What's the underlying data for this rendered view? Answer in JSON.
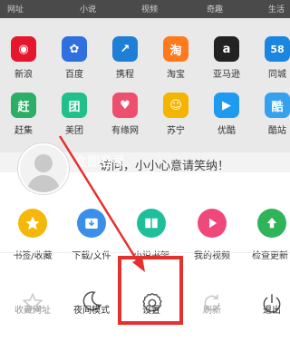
{
  "topnav": [
    "网址",
    "小说",
    "视频",
    "奇趣",
    "生活"
  ],
  "apps_row1": [
    {
      "label": "新浪",
      "icon": "weibo-icon",
      "color": "#e6162d",
      "glyph": "◉"
    },
    {
      "label": "百度",
      "icon": "baidu-paw-icon",
      "color": "#2f6fe0",
      "glyph": "✿"
    },
    {
      "label": "携程",
      "icon": "ctrip-icon",
      "color": "#1f7fd6",
      "glyph": "↗"
    },
    {
      "label": "淘宝",
      "icon": "taobao-icon",
      "color": "#ff7a1c",
      "glyph": "淘"
    },
    {
      "label": "亚马逊",
      "icon": "amazon-icon",
      "color": "#222222",
      "glyph": "a"
    },
    {
      "label": "同城",
      "icon": "tongcheng-icon",
      "color": "#1b86e0",
      "glyph": "58"
    }
  ],
  "apps_row2": [
    {
      "label": "赶集",
      "icon": "ganji-icon",
      "color": "#2bae66",
      "glyph": "赶"
    },
    {
      "label": "美团",
      "icon": "meituan-icon",
      "color": "#21c08b",
      "glyph": "团"
    },
    {
      "label": "有缘网",
      "icon": "youyuan-icon",
      "color": "#ef4f6f",
      "glyph": "♥"
    },
    {
      "label": "苏宁",
      "icon": "suning-icon",
      "color": "#f5b400",
      "glyph": "☺"
    },
    {
      "label": "优酷",
      "icon": "youku-icon",
      "color": "#1e9bf0",
      "glyph": "▶"
    },
    {
      "label": "酷站",
      "icon": "kuzhan-icon",
      "color": "#33a1ee",
      "glyph": "酷"
    }
  ],
  "banner_text": "访问，小小心意请笑纳！",
  "login_text": "立即登录",
  "menu_row1": [
    {
      "label": "书签/收藏",
      "icon": "star-icon",
      "color": "#f5b70a",
      "glyph": "★"
    },
    {
      "label": "下载/文件",
      "icon": "download-icon",
      "color": "#3a8fe8",
      "glyph": "⬇"
    },
    {
      "label": "小说书架",
      "icon": "book-icon",
      "color": "#1fbf9c",
      "glyph": "▤"
    },
    {
      "label": "我的视频",
      "icon": "play-icon",
      "color": "#f0487a",
      "glyph": "▶"
    },
    {
      "label": "检查更新",
      "icon": "update-arrow-icon",
      "color": "#2fb45a",
      "glyph": "⬆"
    }
  ],
  "menu_row2": [
    {
      "label": "收藏网址",
      "icon": "star-plus-icon",
      "glyph": "☆",
      "dim": true
    },
    {
      "label": "夜间模式",
      "icon": "moon-icon",
      "glyph": "☾",
      "dim": false
    },
    {
      "label": "设置",
      "icon": "gear-icon",
      "glyph": "⚙",
      "dim": false
    },
    {
      "label": "刷新",
      "icon": "refresh-icon",
      "glyph": "↻",
      "dim": true
    },
    {
      "label": "退出",
      "icon": "power-icon",
      "glyph": "⏻",
      "dim": false
    }
  ],
  "highlight_color": "#e5312e"
}
